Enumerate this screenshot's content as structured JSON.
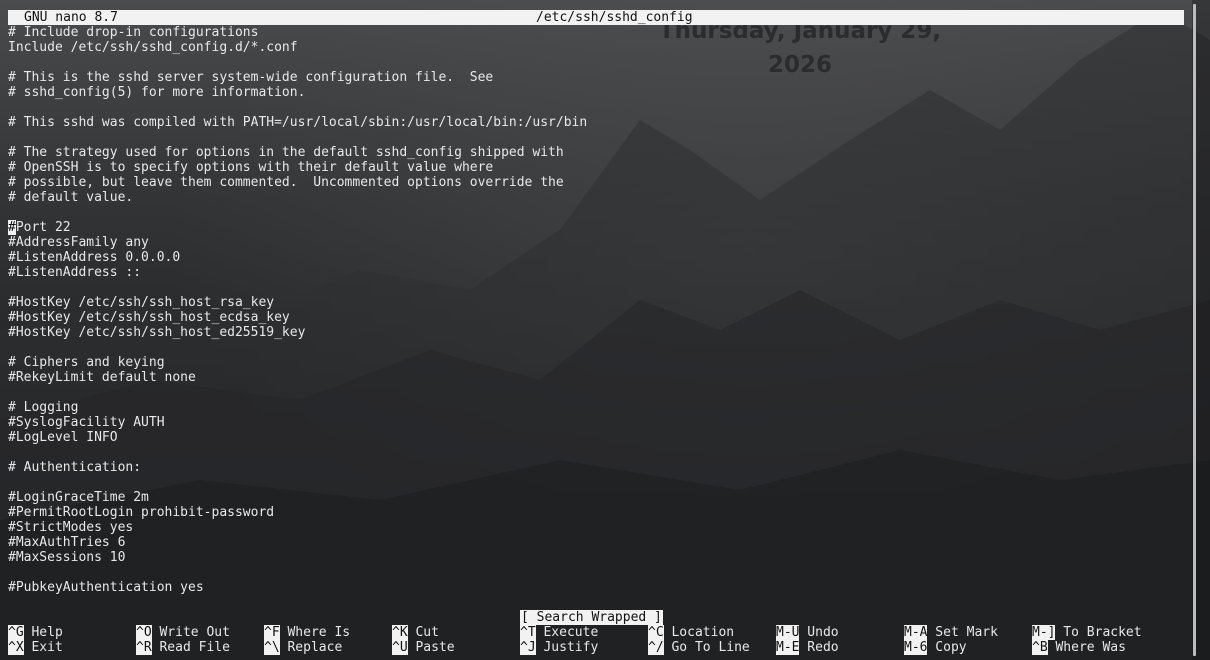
{
  "wallpaper": {
    "clock_text": "Thursday, January 29,\n2026"
  },
  "titlebar": {
    "app": "GNU nano 8.7",
    "filename": "/etc/ssh/sshd_config"
  },
  "lines": [
    "# Include drop-in configurations",
    "Include /etc/ssh/sshd_config.d/*.conf",
    "",
    "# This is the sshd server system-wide configuration file.  See",
    "# sshd_config(5) for more information.",
    "",
    "# This sshd was compiled with PATH=/usr/local/sbin:/usr/local/bin:/usr/bin",
    "",
    "# The strategy used for options in the default sshd_config shipped with",
    "# OpenSSH is to specify options with their default value where",
    "# possible, but leave them commented.  Uncommented options override the",
    "# default value.",
    "",
    "#Port 22",
    "#AddressFamily any",
    "#ListenAddress 0.0.0.0",
    "#ListenAddress ::",
    "",
    "#HostKey /etc/ssh/ssh_host_rsa_key",
    "#HostKey /etc/ssh/ssh_host_ecdsa_key",
    "#HostKey /etc/ssh/ssh_host_ed25519_key",
    "",
    "# Ciphers and keying",
    "#RekeyLimit default none",
    "",
    "# Logging",
    "#SyslogFacility AUTH",
    "#LogLevel INFO",
    "",
    "# Authentication:",
    "",
    "#LoginGraceTime 2m",
    "#PermitRootLogin prohibit-password",
    "#StrictModes yes",
    "#MaxAuthTries 6",
    "#MaxSessions 10",
    "",
    "#PubkeyAuthentication yes"
  ],
  "cursor": {
    "line": 13,
    "col": 0
  },
  "status_message": "[ Search Wrapped ]",
  "shortcuts": {
    "row1": [
      {
        "key": "^G",
        "label": "Help"
      },
      {
        "key": "^O",
        "label": "Write Out"
      },
      {
        "key": "^F",
        "label": "Where Is"
      },
      {
        "key": "^K",
        "label": "Cut"
      },
      {
        "key": "^T",
        "label": "Execute"
      },
      {
        "key": "^C",
        "label": "Location"
      },
      {
        "key": "M-U",
        "label": "Undo"
      },
      {
        "key": "M-A",
        "label": "Set Mark"
      },
      {
        "key": "M-]",
        "label": "To Bracket"
      }
    ],
    "row2": [
      {
        "key": "^X",
        "label": "Exit"
      },
      {
        "key": "^R",
        "label": "Read File"
      },
      {
        "key": "^\\",
        "label": "Replace"
      },
      {
        "key": "^U",
        "label": "Paste"
      },
      {
        "key": "^J",
        "label": "Justify"
      },
      {
        "key": "^/",
        "label": "Go To Line"
      },
      {
        "key": "M-E",
        "label": "Redo"
      },
      {
        "key": "M-6",
        "label": "Copy"
      },
      {
        "key": "^B",
        "label": "Where Was"
      }
    ]
  }
}
